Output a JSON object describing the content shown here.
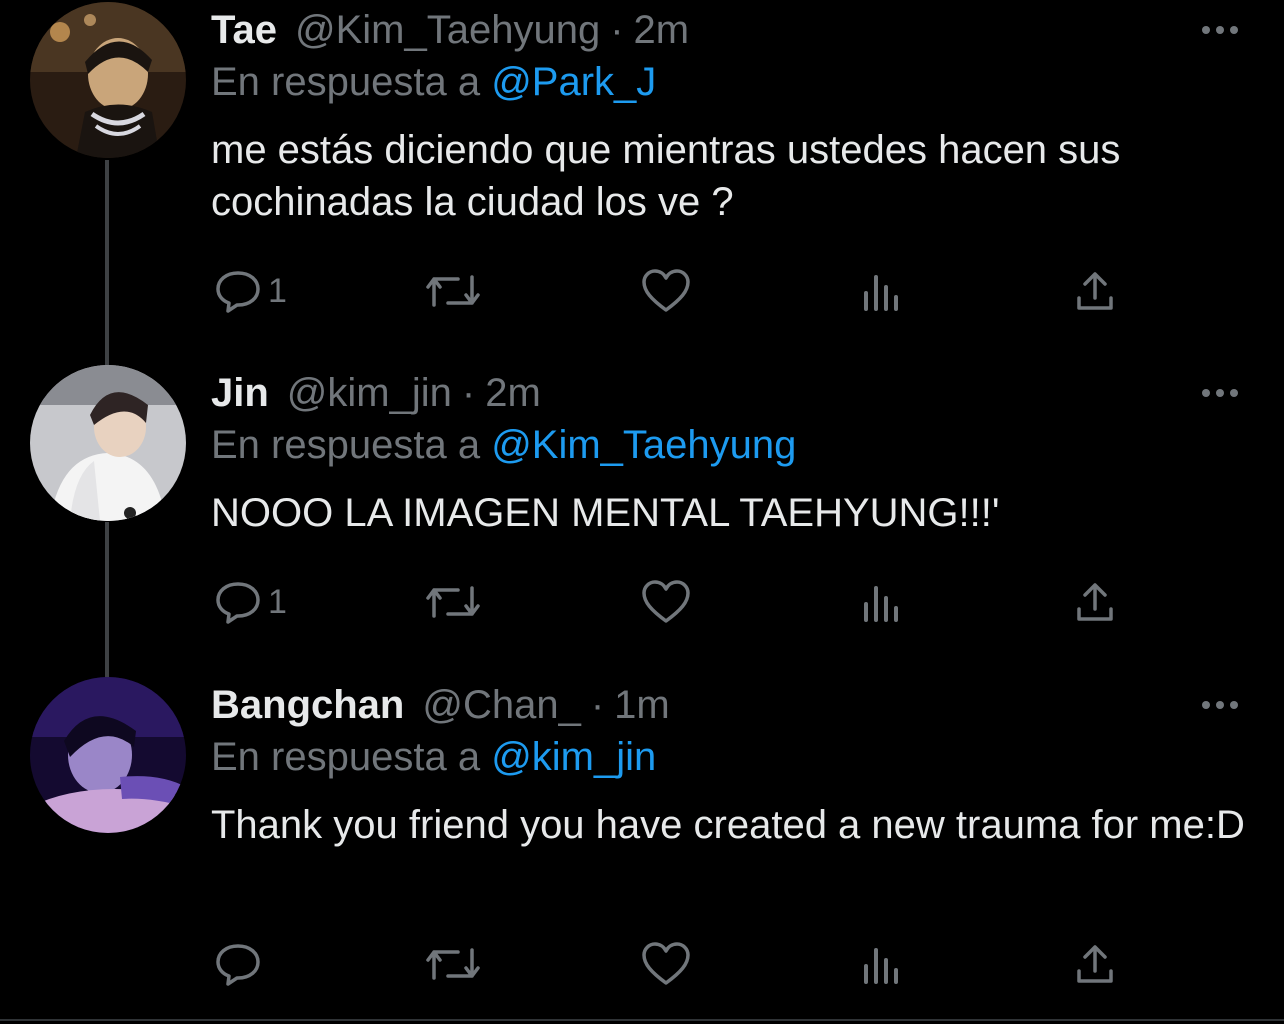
{
  "tweets": [
    {
      "name": "Tae",
      "handle": "@Kim_Taehyung",
      "separator": "·",
      "time": "2m",
      "reply_prefix": "En respuesta a",
      "reply_mention": "@Park_J",
      "text": "me estás diciendo que mientras ustedes hacen sus cochinadas la ciudad los ve ?",
      "reply_count": "1",
      "avatar_colors": [
        "#3a2a1a",
        "#c9a57a",
        "#1a1410"
      ]
    },
    {
      "name": "Jin",
      "handle": "@kim_jin",
      "separator": "·",
      "time": "2m",
      "reply_prefix": "En respuesta a",
      "reply_mention": "@Kim_Taehyung",
      "text": "NOOO LA IMAGEN MENTAL TAEHYUNG!!!'",
      "reply_count": "1",
      "avatar_colors": [
        "#d9d9dc",
        "#f2f2f2",
        "#3b3030"
      ]
    },
    {
      "name": "Bangchan",
      "handle": "@Chan_",
      "separator": "·",
      "time": "1m",
      "reply_prefix": "En respuesta a",
      "reply_mention": "@kim_jin",
      "text": "Thank you friend you have created a new trauma for me:D",
      "reply_count": "",
      "avatar_colors": [
        "#1b0f3a",
        "#6b4fb5",
        "#c9a3d6"
      ]
    }
  ],
  "icons": {
    "reply": "reply-icon",
    "retweet": "retweet-icon",
    "like": "heart-icon",
    "analytics": "analytics-icon",
    "share": "share-icon",
    "more": "more-icon"
  },
  "colors": {
    "background": "#000000",
    "text": "#e7e9ea",
    "muted": "#71767b",
    "link": "#1d9bf0",
    "thread_line": "#3e4144"
  }
}
